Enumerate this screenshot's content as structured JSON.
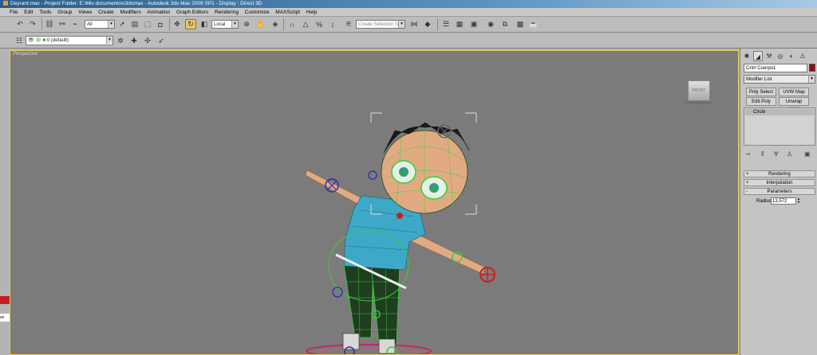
{
  "window": {
    "title": "Deyrant.max     - Project Folder: E:\\Mis documentos\\3dsmax     - Autodesk 3ds Max  2009 SP1     - Display : Direct 3D"
  },
  "menu": [
    "File",
    "Edit",
    "Tools",
    "Group",
    "Views",
    "Create",
    "Modifiers",
    "Animation",
    "Graph Editors",
    "Rendering",
    "Customize",
    "MAXScript",
    "Help"
  ],
  "toolbar": {
    "selection_filter": "All",
    "reference_coord": "Local",
    "named_selection_placeholder": "Create Selection Se",
    "layer": "0 (default)"
  },
  "viewport": {
    "label": "Perspective",
    "viewcube_face": "FRONT"
  },
  "command_panel": {
    "object_name": "Cntrl Cuerpo1",
    "object_color": "#8e0f0f",
    "modifier_list": "Modifier List",
    "buttons": [
      "Poly Select",
      "UVW Map",
      "Edit Poly",
      "Unwrap UVW"
    ],
    "stack_item": "Circle",
    "rollouts": [
      {
        "sign": "+",
        "label": "Rendering"
      },
      {
        "sign": "+",
        "label": "Interpolation"
      },
      {
        "sign": "-",
        "label": "Parameters"
      }
    ],
    "radius_label": "Radius:",
    "radius_value": "13,572"
  },
  "left_strip": {
    "text": "ax"
  },
  "colors": {
    "viewport_bg": "#7b7b7b",
    "active_border": "#e5d04a",
    "wireframe_green": "#35d135",
    "control_red": "#c82020",
    "control_blue": "#2a2ab8",
    "shirt": "#3ea8c8",
    "skin": "#e2aa82"
  }
}
